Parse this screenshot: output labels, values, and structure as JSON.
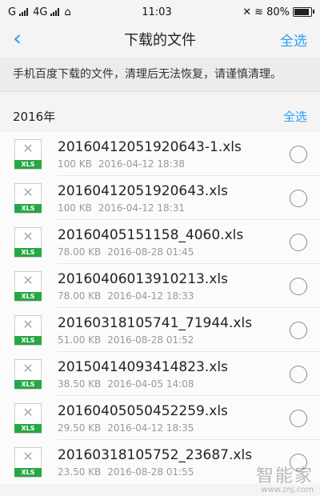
{
  "status": {
    "carrier_left": "G",
    "carrier_right": "4G",
    "time": "11:03",
    "battery": "80%",
    "battery_level": 0.8
  },
  "header": {
    "back_icon": "chevron-left-icon",
    "title": "下载的文件",
    "select_all": "全选"
  },
  "notice": "手机百度下载的文件，清理后无法恢复，请谨慎清理。",
  "section": {
    "year": "2016年",
    "select_all": "全选"
  },
  "files": [
    {
      "name": "20160412051920643-1.xls",
      "size": "100 KB",
      "date": "2016-04-12 18:38",
      "type": "XLS"
    },
    {
      "name": "20160412051920643.xls",
      "size": "100 KB",
      "date": "2016-04-12 18:31",
      "type": "XLS"
    },
    {
      "name": "20160405151158_4060.xls",
      "size": "78.00 KB",
      "date": "2016-08-28 01:45",
      "type": "XLS"
    },
    {
      "name": "20160406013910213.xls",
      "size": "78.00 KB",
      "date": "2016-04-12 18:33",
      "type": "XLS"
    },
    {
      "name": "20160318105741_71944.xls",
      "size": "51.00 KB",
      "date": "2016-08-28 01:52",
      "type": "XLS"
    },
    {
      "name": "20150414093414823.xls",
      "size": "38.50 KB",
      "date": "2016-04-05 14:08",
      "type": "XLS"
    },
    {
      "name": "20160405050452259.xls",
      "size": "29.50 KB",
      "date": "2016-04-12 18:35",
      "type": "XLS"
    },
    {
      "name": "20160318105752_23687.xls",
      "size": "23.50 KB",
      "date": "2016-08-28 01:55",
      "type": "XLS"
    }
  ],
  "watermark": {
    "text": "智能家",
    "url": "www.znj.com"
  },
  "colors": {
    "accent": "#2a9df4",
    "xls_tag": "#27a744"
  }
}
